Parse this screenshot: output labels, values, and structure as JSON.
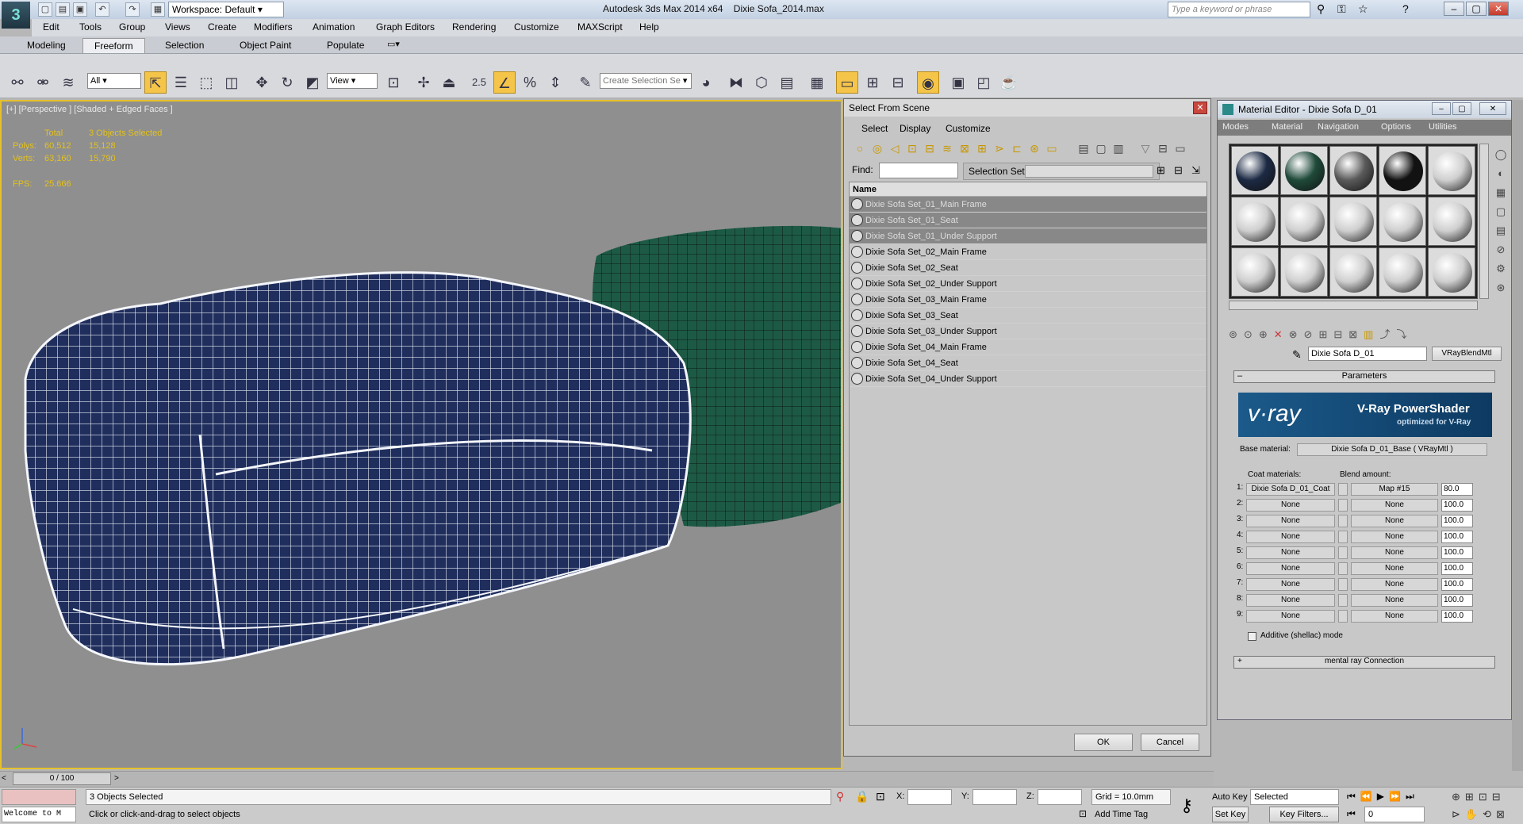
{
  "titlebar": {
    "workspace": "Workspace: Default",
    "app_title": "Autodesk 3ds Max  2014 x64",
    "file_name": "Dixie Sofa_2014.max",
    "search_placeholder": "Type a keyword or phrase"
  },
  "menubar": [
    "Edit",
    "Tools",
    "Group",
    "Views",
    "Create",
    "Modifiers",
    "Animation",
    "Graph Editors",
    "Rendering",
    "Customize",
    "MAXScript",
    "Help"
  ],
  "ribbon_tabs": [
    "Modeling",
    "Freeform",
    "Selection",
    "Object Paint",
    "Populate"
  ],
  "toolbar": {
    "filter_value": "All",
    "view_value": "View",
    "num_label": "2.5",
    "create_selection_set": "Create Selection Se"
  },
  "viewport": {
    "label": "[+] [Perspective ] [Shaded + Edged Faces ]",
    "stats": {
      "total_label": "Total",
      "selected_label": "3 Objects Selected",
      "polys_label": "Polys:",
      "polys_total": "60,512",
      "polys_sel": "15,128",
      "verts_label": "Verts:",
      "verts_total": "63,160",
      "verts_sel": "15,790",
      "fps_label": "FPS:",
      "fps_value": "25.666"
    }
  },
  "select_from_scene": {
    "title": "Select From Scene",
    "tabs": [
      "Select",
      "Display",
      "Customize"
    ],
    "find_label": "Find:",
    "selection_set_label": "Selection Set:",
    "column_name": "Name",
    "rows": [
      {
        "name": "Dixie Sofa Set_01_Main Frame",
        "selected": true
      },
      {
        "name": "Dixie Sofa Set_01_Seat",
        "selected": true
      },
      {
        "name": "Dixie Sofa Set_01_Under Support",
        "selected": true
      },
      {
        "name": "Dixie Sofa Set_02_Main Frame",
        "selected": false
      },
      {
        "name": "Dixie Sofa Set_02_Seat",
        "selected": false
      },
      {
        "name": "Dixie Sofa Set_02_Under Support",
        "selected": false
      },
      {
        "name": "Dixie Sofa Set_03_Main Frame",
        "selected": false
      },
      {
        "name": "Dixie Sofa Set_03_Seat",
        "selected": false
      },
      {
        "name": "Dixie Sofa Set_03_Under Support",
        "selected": false
      },
      {
        "name": "Dixie Sofa Set_04_Main Frame",
        "selected": false
      },
      {
        "name": "Dixie Sofa Set_04_Seat",
        "selected": false
      },
      {
        "name": "Dixie Sofa Set_04_Under Support",
        "selected": false
      }
    ],
    "ok": "OK",
    "cancel": "Cancel"
  },
  "material_editor": {
    "title": "Material Editor - Dixie Sofa D_01",
    "menus": [
      "Modes",
      "Material",
      "Navigation",
      "Options",
      "Utilities"
    ],
    "material_name": "Dixie Sofa D_01",
    "material_type": "VRayBlendMtl",
    "rollout_parameters": "Parameters",
    "vray_logo": "v·ray",
    "vray_title": "V-Ray PowerShader",
    "vray_sub": "optimized for V-Ray",
    "base_label": "Base material:",
    "base_value": "Dixie Sofa D_01_Base  ( VRayMtl )",
    "coat_label": "Coat materials:",
    "blend_label": "Blend amount:",
    "coats": [
      {
        "idx": "1:",
        "mat": "Dixie Sofa D_01_Coat",
        "map": "Map #15",
        "val": "80.0"
      },
      {
        "idx": "2:",
        "mat": "None",
        "map": "None",
        "val": "100.0"
      },
      {
        "idx": "3:",
        "mat": "None",
        "map": "None",
        "val": "100.0"
      },
      {
        "idx": "4:",
        "mat": "None",
        "map": "None",
        "val": "100.0"
      },
      {
        "idx": "5:",
        "mat": "None",
        "map": "None",
        "val": "100.0"
      },
      {
        "idx": "6:",
        "mat": "None",
        "map": "None",
        "val": "100.0"
      },
      {
        "idx": "7:",
        "mat": "None",
        "map": "None",
        "val": "100.0"
      },
      {
        "idx": "8:",
        "mat": "None",
        "map": "None",
        "val": "100.0"
      },
      {
        "idx": "9:",
        "mat": "None",
        "map": "None",
        "val": "100.0"
      }
    ],
    "additive_label": "Additive (shellac) mode",
    "rollout_mental": "mental ray Connection",
    "slot_colors": [
      "#1c2a44",
      "#1f4a3a",
      "#5a5a5a",
      "#121212",
      "#cfcfcf",
      "#cfcfcf",
      "#cfcfcf",
      "#cfcfcf",
      "#cfcfcf",
      "#cfcfcf",
      "#cfcfcf",
      "#cfcfcf",
      "#cfcfcf",
      "#cfcfcf",
      "#cfcfcf"
    ]
  },
  "timeline": {
    "frame": "0 / 100"
  },
  "status": {
    "selected": "3 Objects Selected",
    "prompt": "Click or click-and-drag to select objects",
    "maxscript": "Welcome to M",
    "x_label": "X:",
    "y_label": "Y:",
    "z_label": "Z:",
    "grid": "Grid = 10.0mm",
    "add_time_tag": "Add Time Tag",
    "auto_key": "Auto Key",
    "set_key": "Set Key",
    "key_mode": "Selected",
    "key_filters": "Key Filters...",
    "frame_value": "0"
  },
  "colors": {
    "sofa_blue": "#1f2e5c",
    "sofa_green": "#1d5a45",
    "viewport_bg": "#8f8f8f",
    "active_border": "#e6c12c",
    "stat_yellow": "#e4c11a"
  }
}
